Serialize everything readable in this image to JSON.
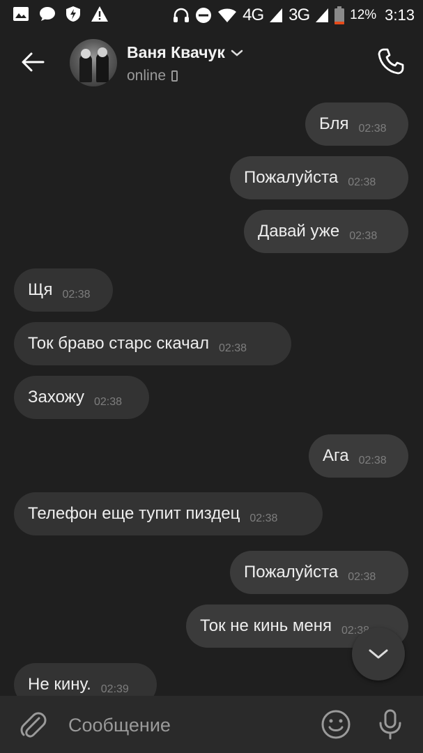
{
  "status_bar": {
    "network_4g": "4G",
    "network_3g": "3G",
    "battery": "12%",
    "time": "3:13"
  },
  "header": {
    "contact_name": "Ваня Квачук",
    "status": "online"
  },
  "messages": [
    {
      "text": "Бля",
      "time": "02:38",
      "direction": "out"
    },
    {
      "text": "Пожалуйста",
      "time": "02:38",
      "direction": "out"
    },
    {
      "text": "Давай уже",
      "time": "02:38",
      "direction": "out"
    },
    {
      "text": "Щя",
      "time": "02:38",
      "direction": "in"
    },
    {
      "text": "Ток браво старс скачал",
      "time": "02:38",
      "direction": "in"
    },
    {
      "text": "Захожу",
      "time": "02:38",
      "direction": "in"
    },
    {
      "text": "Ага",
      "time": "02:38",
      "direction": "out"
    },
    {
      "text": "Телефон еще тупит пиздец",
      "time": "02:38",
      "direction": "in"
    },
    {
      "text": "Пожалуйста",
      "time": "02:38",
      "direction": "out"
    },
    {
      "text": "Ток не кинь меня",
      "time": "02:38",
      "direction": "out"
    },
    {
      "text": "Не кину.",
      "time": "02:39",
      "direction": "in"
    }
  ],
  "composer": {
    "placeholder": "Сообщение"
  },
  "colors": {
    "background": "#1f1f1f",
    "bubble_in": "#333333",
    "bubble_out": "#3b3b3b",
    "timestamp": "#7e7e7e"
  },
  "icons": [
    "back-arrow-icon",
    "chevron-down-icon",
    "mobile-icon",
    "phone-icon",
    "chevron-down-icon",
    "paperclip-icon",
    "emoji-icon",
    "microphone-icon"
  ]
}
